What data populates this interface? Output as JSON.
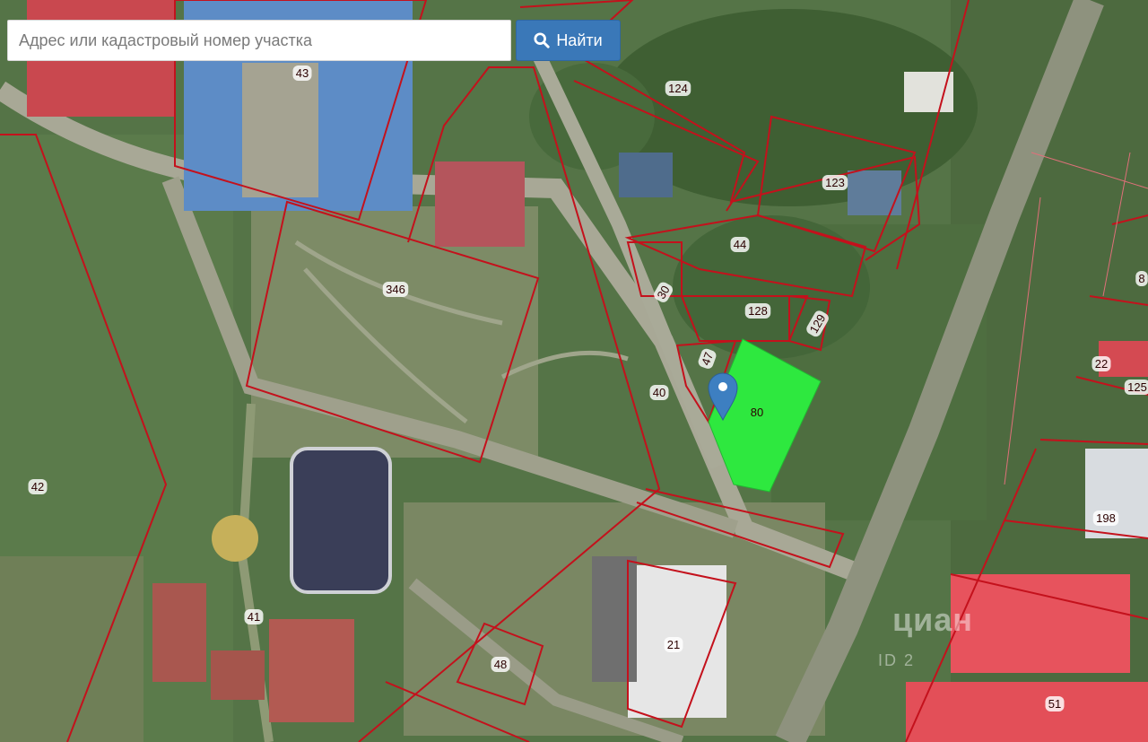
{
  "search": {
    "placeholder": "Адрес или кадастровый номер участка",
    "button_label": "Найти",
    "icon": "search-icon"
  },
  "map": {
    "parcel_labels": [
      "43",
      "124",
      "123",
      "44",
      "30",
      "128",
      "129",
      "47",
      "80",
      "346",
      "40",
      "42",
      "41",
      "48",
      "21",
      "198",
      "22",
      "125",
      "8",
      "51"
    ],
    "highlight_color": "#2ee83f",
    "boundary_color": "#c4111c",
    "marker_color": "#3d7fc1"
  },
  "watermark": {
    "id_text": "ID 2",
    "logo": "циан"
  }
}
